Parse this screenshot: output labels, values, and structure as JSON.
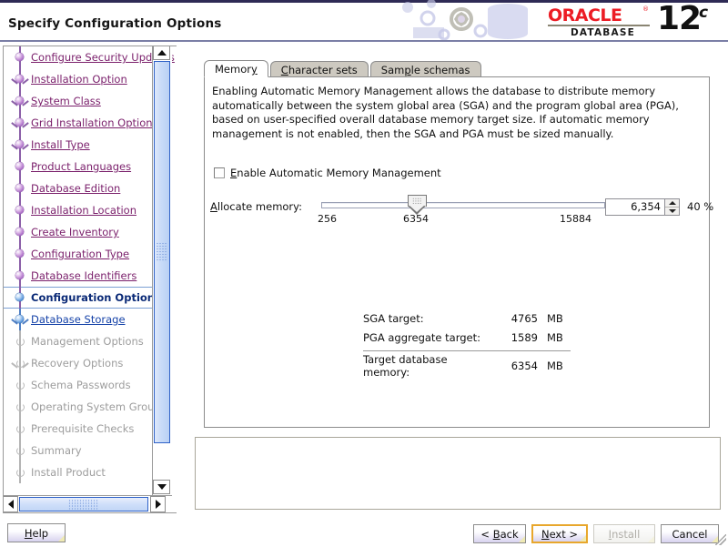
{
  "header": {
    "title": "Specify Configuration Options",
    "brand_word": "ORACLE",
    "brand_reg": "®",
    "brand_sub": "DATABASE",
    "brand_version": "12",
    "brand_version_suffix": "c",
    "accent_red": "#ec1c24"
  },
  "sidebar": {
    "items": [
      {
        "label": "Configure Security Updates",
        "state": "done",
        "branch": false
      },
      {
        "label": "Installation Option",
        "state": "done",
        "branch": true
      },
      {
        "label": "System Class",
        "state": "done",
        "branch": true
      },
      {
        "label": "Grid Installation Options",
        "state": "done",
        "branch": true
      },
      {
        "label": "Install Type",
        "state": "done",
        "branch": true
      },
      {
        "label": "Product Languages",
        "state": "done",
        "branch": false
      },
      {
        "label": "Database Edition",
        "state": "done",
        "branch": false
      },
      {
        "label": "Installation Location",
        "state": "done",
        "branch": false
      },
      {
        "label": "Create Inventory",
        "state": "done",
        "branch": false
      },
      {
        "label": "Configuration Type",
        "state": "done",
        "branch": false
      },
      {
        "label": "Database Identifiers",
        "state": "done",
        "branch": false
      },
      {
        "label": "Configuration Options",
        "state": "current",
        "branch": false
      },
      {
        "label": "Database Storage",
        "state": "next",
        "branch": true
      },
      {
        "label": "Management Options",
        "state": "disabled",
        "branch": false
      },
      {
        "label": "Recovery Options",
        "state": "disabled",
        "branch": true
      },
      {
        "label": "Schema Passwords",
        "state": "disabled",
        "branch": false
      },
      {
        "label": "Operating System Groups",
        "state": "disabled",
        "branch": false
      },
      {
        "label": "Prerequisite Checks",
        "state": "disabled",
        "branch": false
      },
      {
        "label": "Summary",
        "state": "disabled",
        "branch": false
      },
      {
        "label": "Install Product",
        "state": "disabled",
        "branch": false
      }
    ],
    "link_color": "#7a1f6b",
    "current_color": "#0b2a77",
    "disabled_color": "#9d9d9d"
  },
  "main": {
    "tabs": [
      {
        "label": "Memory",
        "mnemonic": "y",
        "active": true
      },
      {
        "label": "Character sets",
        "mnemonic": "C",
        "active": false
      },
      {
        "label": "Sample schemas",
        "mnemonic": "p",
        "active": false
      }
    ],
    "description": "Enabling Automatic Memory Management allows the database to distribute memory automatically between the system global area (SGA) and the program global area (PGA),  based on user-specified overall database memory target size. If automatic memory management is not enabled, then the SGA and PGA must be sized manually.",
    "amm_checkbox": {
      "label": "Enable Automatic Memory Management",
      "checked": false,
      "mnemonic": "E"
    },
    "allocate": {
      "label": "Allocate memory:",
      "mnemonic": "A",
      "min": "256",
      "current": "6354",
      "max": "15884",
      "spinner_value": "6,354",
      "percent": "40 %"
    },
    "summary": {
      "rows": [
        {
          "name": "SGA target:",
          "value": "4765",
          "unit": "MB"
        },
        {
          "name": "PGA aggregate target:",
          "value": "1589",
          "unit": "MB"
        }
      ],
      "total": {
        "name": "Target database memory:",
        "value": "6354",
        "unit": "MB"
      }
    }
  },
  "footer": {
    "help": {
      "label": "Help",
      "mnemonic": "H",
      "enabled": true,
      "focused": false
    },
    "back": {
      "label": "< Back",
      "mnemonic": "B",
      "enabled": true,
      "focused": false
    },
    "next": {
      "label": "Next >",
      "mnemonic": "N",
      "enabled": true,
      "focused": true
    },
    "install": {
      "label": "Install",
      "mnemonic": "I",
      "enabled": false,
      "focused": false
    },
    "cancel": {
      "label": "Cancel",
      "mnemonic": "",
      "enabled": true,
      "focused": false
    }
  }
}
